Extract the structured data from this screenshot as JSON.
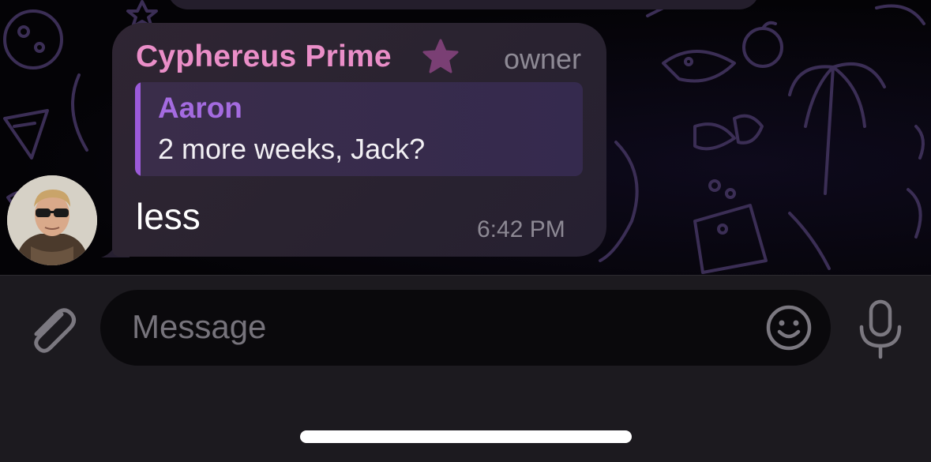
{
  "message": {
    "sender_name": "Cyphereus Prime",
    "sender_role": "owner",
    "reply": {
      "author": "Aaron",
      "text": "2 more weeks, Jack?"
    },
    "text": "less",
    "time": "6:42 PM"
  },
  "composer": {
    "placeholder": "Message"
  },
  "colors": {
    "sender_name": "#ea8ec8",
    "reply_accent": "#a46be0",
    "bubble": "#2a2330",
    "input_bar": "#1c1a1f"
  },
  "icons": {
    "badge": "star-icon",
    "attach": "paperclip-icon",
    "emoji": "smiley-icon",
    "voice": "microphone-icon"
  }
}
